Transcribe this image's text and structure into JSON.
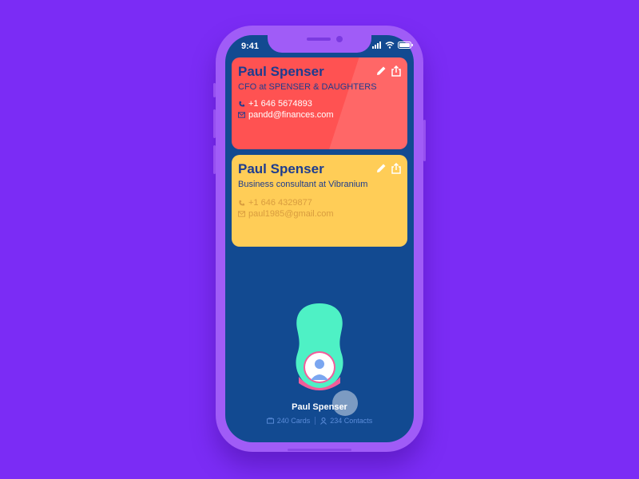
{
  "status_bar": {
    "time": "9:41"
  },
  "cards": [
    {
      "name": "Paul Spenser",
      "role": "CFO at SPENSER & DAUGHTERS",
      "phone": "+1 646 5674893",
      "email": "pandd@finances.com",
      "color": "#ff5252"
    },
    {
      "name": "Paul Spenser",
      "role": "Business consultant at Vibranium",
      "phone": "+1 646 4329877",
      "email": "paul1985@gmail.com",
      "color": "#ffcd57"
    }
  ],
  "profile": {
    "name": "Paul Spenser",
    "cards_count": "240 Cards",
    "contacts_count": "234 Contacts"
  },
  "colors": {
    "background": "#7b2cf5",
    "phone_frame": "#a05cf7",
    "screen": "#124a91",
    "blob": "#4ef1c5",
    "name_text": "#1d3c8f"
  },
  "icons": [
    "signal-icon",
    "wifi-icon",
    "battery-icon",
    "edit-icon",
    "share-icon",
    "phone-icon",
    "mail-icon",
    "cards-icon",
    "contacts-icon",
    "user-avatar-icon"
  ]
}
